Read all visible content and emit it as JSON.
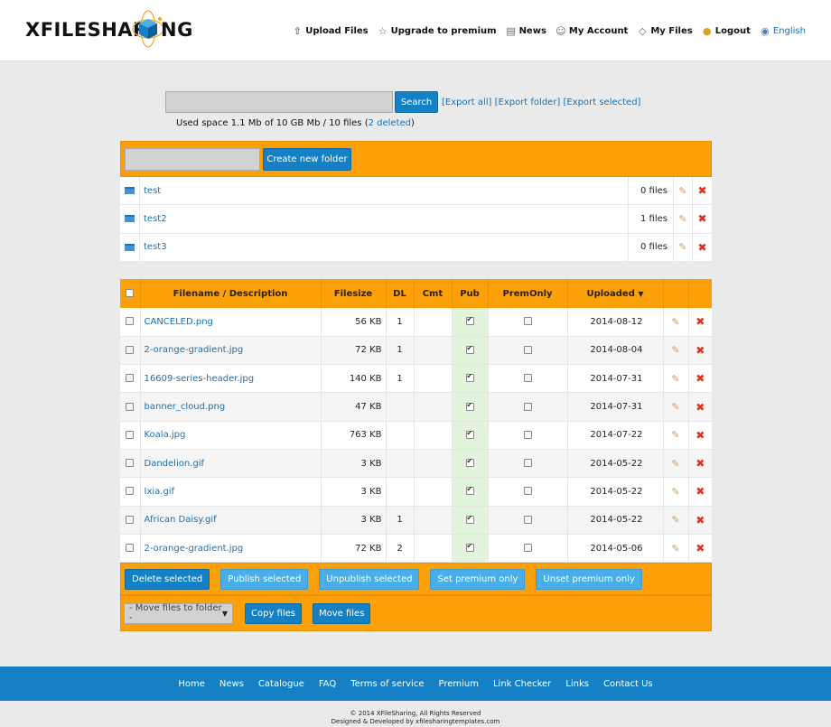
{
  "logo": {
    "left": "XFILESHAR",
    "right": "NG"
  },
  "nav": [
    {
      "label": "Upload Files",
      "icon": "upload-icon"
    },
    {
      "label": "Upgrade to premium",
      "icon": "star-icon"
    },
    {
      "label": "News",
      "icon": "news-icon"
    },
    {
      "label": "My Account",
      "icon": "user-icon"
    },
    {
      "label": "My Files",
      "icon": "file-icon"
    },
    {
      "label": "Logout",
      "icon": "logout-icon"
    },
    {
      "label": "English",
      "icon": "globe-icon"
    }
  ],
  "search": {
    "value": "",
    "button": "Search"
  },
  "export": {
    "all": "[Export all]",
    "folder": "[Export folder]",
    "selected": "[Export selected]"
  },
  "used_space": {
    "text": "Used space 1.1 Mb of 10 GB Mb / 10 files (",
    "deleted": "2 deleted",
    "close": ")"
  },
  "folders": {
    "new_folder_value": "",
    "create_button": "Create new folder",
    "items": [
      {
        "name": "test",
        "count": "0 files"
      },
      {
        "name": "test2",
        "count": "1 files"
      },
      {
        "name": "test3",
        "count": "0 files"
      }
    ]
  },
  "table": {
    "headers": {
      "filename": "Filename / Description",
      "filesize": "Filesize",
      "dl": "DL",
      "cmt": "Cmt",
      "pub": "Pub",
      "prem": "PremOnly",
      "uploaded": "Uploaded"
    },
    "rows": [
      {
        "name": "CANCELED.png",
        "size": "56 KB",
        "dl": "1",
        "date": "2014-08-12"
      },
      {
        "name": "2-orange-gradient.jpg",
        "size": "72 KB",
        "dl": "1",
        "date": "2014-08-04"
      },
      {
        "name": "16609-series-header.jpg",
        "size": "140 KB",
        "dl": "1",
        "date": "2014-07-31"
      },
      {
        "name": "banner_cloud.png",
        "size": "47 KB",
        "dl": "",
        "date": "2014-07-31"
      },
      {
        "name": "Koala.jpg",
        "size": "763 KB",
        "dl": "",
        "date": "2014-07-22"
      },
      {
        "name": "Dandelion.gif",
        "size": "3 KB",
        "dl": "",
        "date": "2014-05-22"
      },
      {
        "name": "Ixia.gif",
        "size": "3 KB",
        "dl": "",
        "date": "2014-05-22"
      },
      {
        "name": "African Daisy.gif",
        "size": "3 KB",
        "dl": "1",
        "date": "2014-05-22"
      },
      {
        "name": "2-orange-gradient.jpg",
        "size": "72 KB",
        "dl": "2",
        "date": "2014-05-06"
      }
    ]
  },
  "actions": {
    "delete": "Delete selected",
    "publish": "Publish selected",
    "unpublish": "Unpublish selected",
    "set_premium": "Set premium only",
    "unset_premium": "Unset premium only"
  },
  "move": {
    "select": "- Move files to folder -",
    "copy": "Copy files",
    "move": "Move files"
  },
  "footer": [
    "Home",
    "News",
    "Catalogue",
    "FAQ",
    "Terms of service",
    "Premium",
    "Link Checker",
    "Links",
    "Contact Us"
  ],
  "copyright": {
    "line1": "© 2014 XFileSharing, All Rights Reserved",
    "line2": "Designed & Developed by xfilesharingtemplates.com"
  },
  "colors": {
    "accent": "#fca00a",
    "blue": "#1580c3",
    "pub_bg": "#e2f5dc",
    "delete_red": "#e03020"
  }
}
